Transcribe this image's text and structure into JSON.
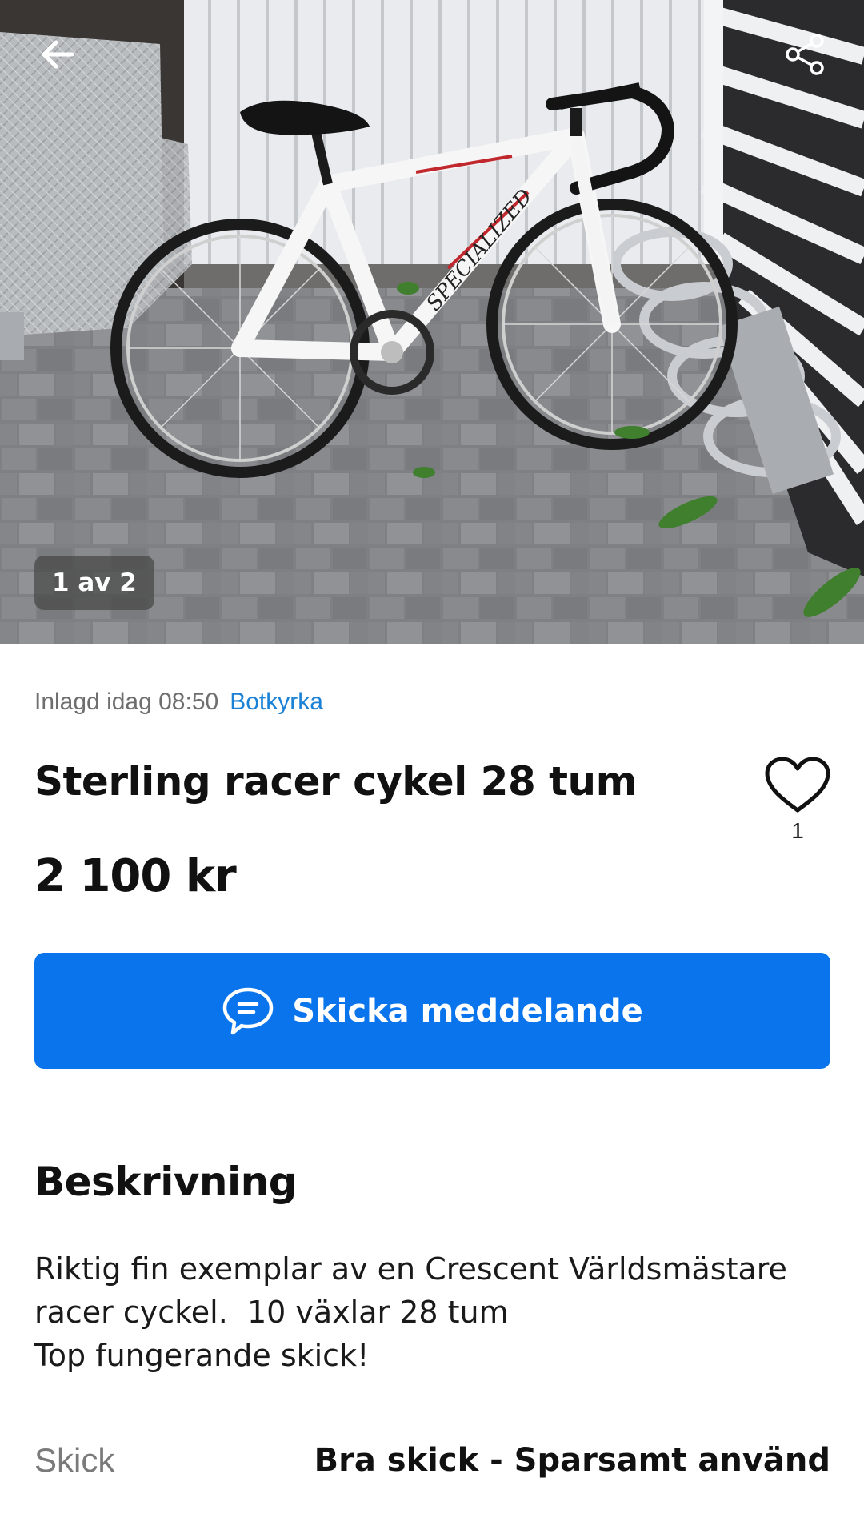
{
  "hero": {
    "image_alt": "white road bike with drop handlebars leaning against a bike rack on a stone pavement",
    "bike_brand_text": "SPECIALIZED",
    "counter": "1 av 2",
    "back_icon": "arrow-left-icon",
    "share_icon": "share-icon"
  },
  "meta": {
    "posted": "Inlagd idag 08:50",
    "location": "Botkyrka"
  },
  "listing": {
    "title": "Sterling racer cykel 28 tum",
    "price": "2 100 kr",
    "favorite_count": "1",
    "favorite_icon": "heart-outline-icon"
  },
  "actions": {
    "message_label": "Skicka meddelande",
    "message_icon": "chat-bubble-icon",
    "accent_color": "#0a74ec"
  },
  "description": {
    "heading": "Beskrivning",
    "lines": [
      "Riktig fin exemplar av en Crescent Världsmästare",
      "racer cyckel.  10 växlar 28 tum",
      "Top fungerande skick!"
    ]
  },
  "details": {
    "condition_label": "Skick",
    "condition_value": "Bra skick - Sparsamt använd"
  }
}
